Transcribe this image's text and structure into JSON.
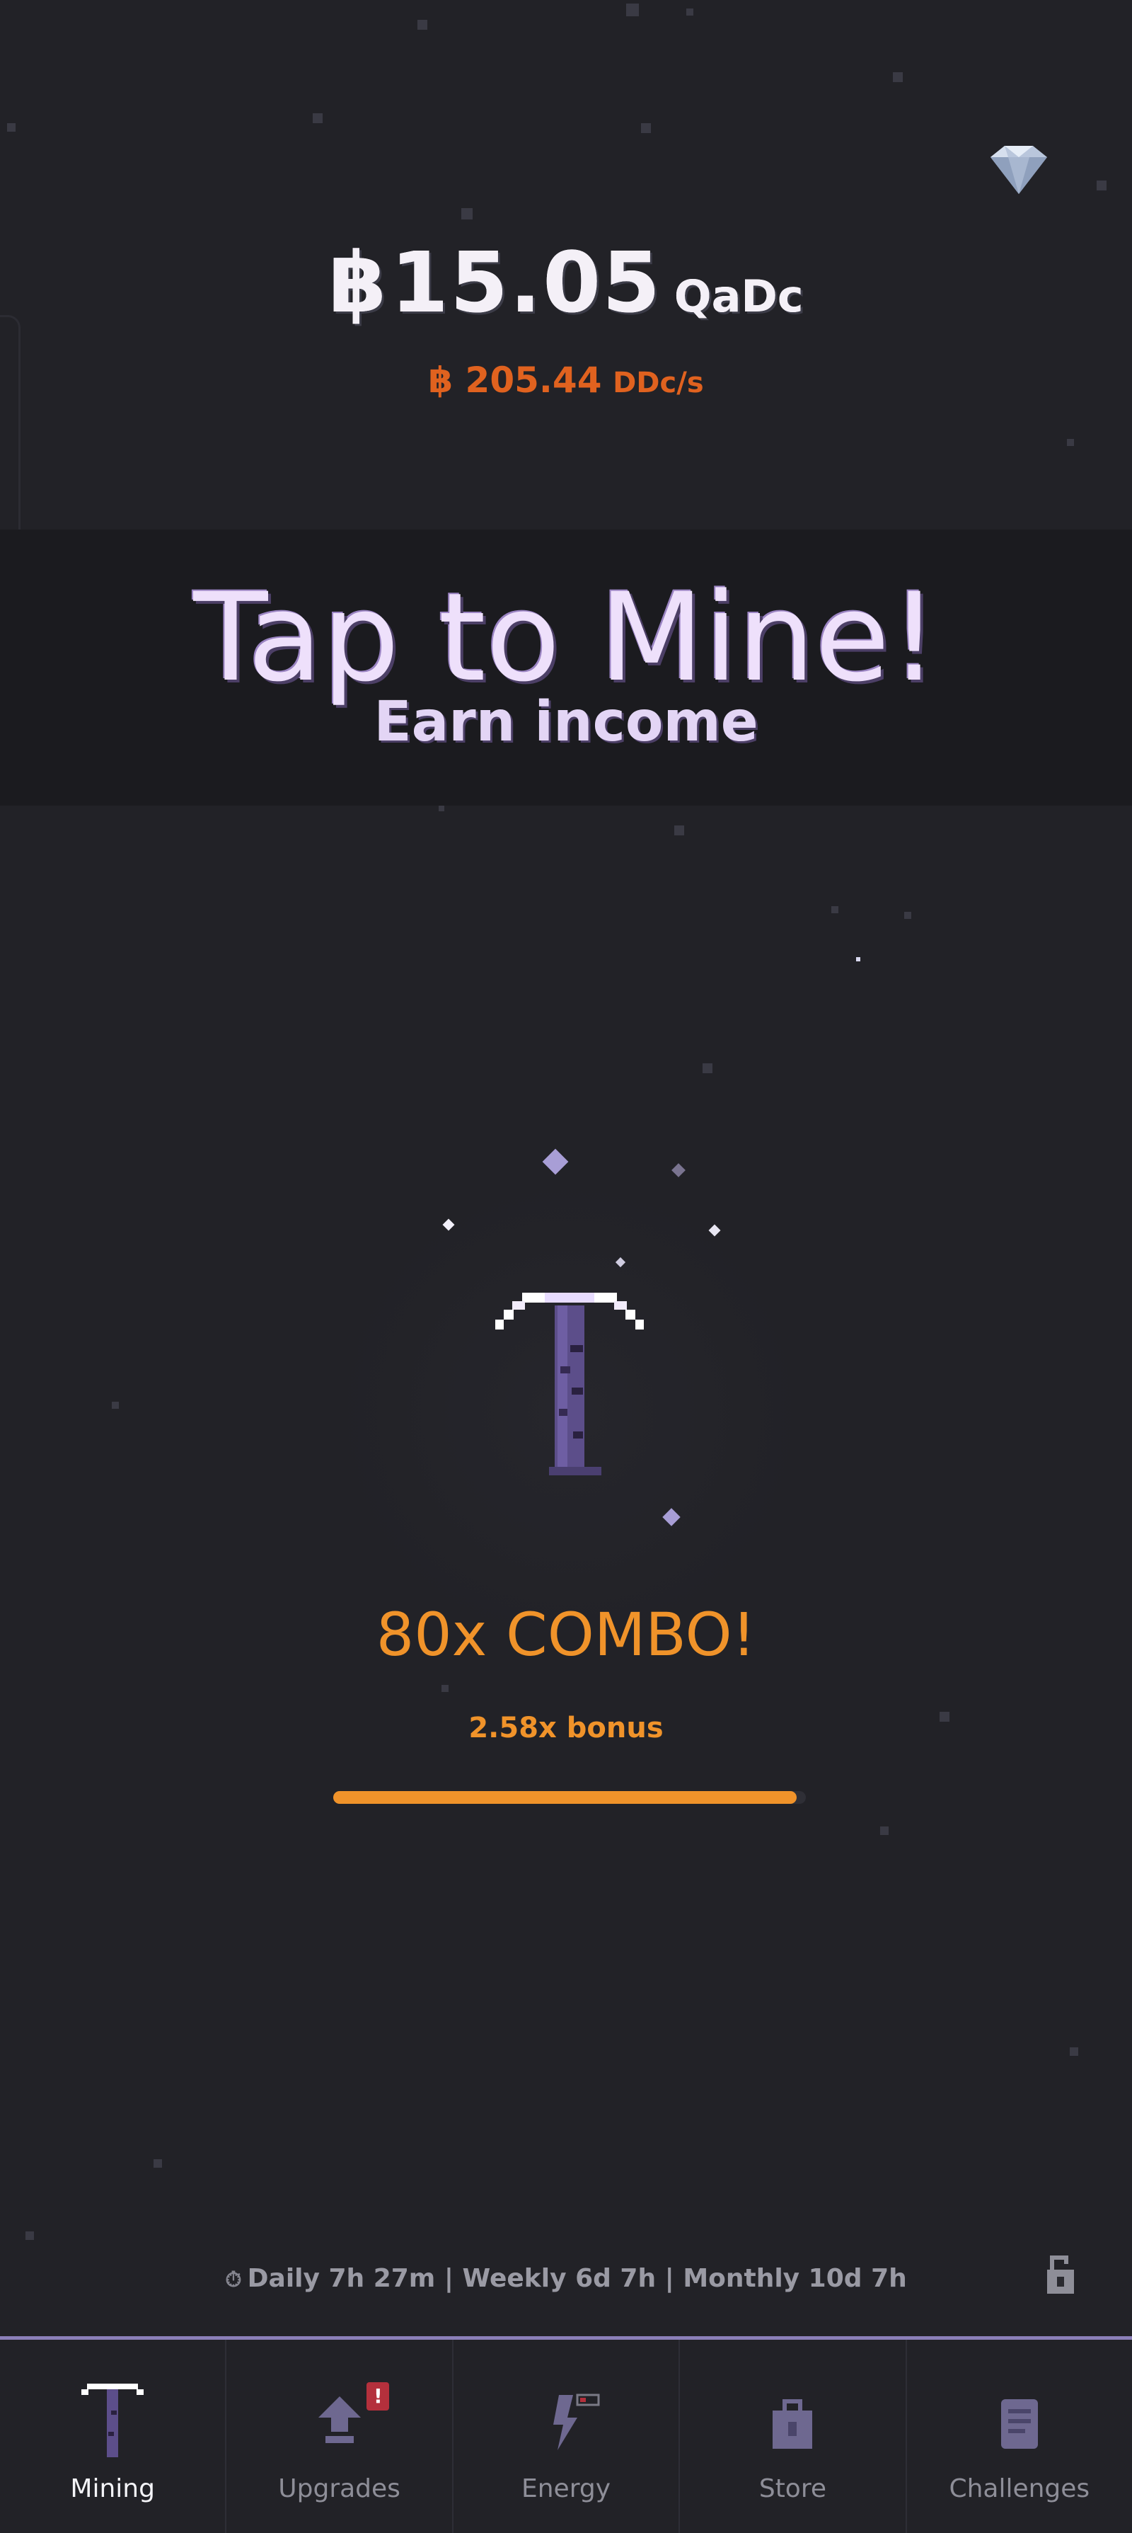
{
  "header": {
    "currency_symbol": "฿",
    "balance_value": "15.05",
    "balance_unit": "QaDc",
    "rate_value": "฿ 205.44",
    "rate_unit": "DDc/s"
  },
  "banner": {
    "title": "Tap to Mine!",
    "subtitle": "Earn income"
  },
  "combo": {
    "label": "80x COMBO!",
    "bonus": "2.58x bonus",
    "progress_fraction": 0.98
  },
  "timers": {
    "text": "Daily 7h 27m | Weekly 6d 7h | Monthly 10d 7h"
  },
  "nav": {
    "items": [
      {
        "label": "Mining",
        "icon": "pickaxe-icon",
        "active": true
      },
      {
        "label": "Upgrades",
        "icon": "upgrade-arrow-icon",
        "badge": "!"
      },
      {
        "label": "Energy",
        "icon": "lightning-icon"
      },
      {
        "label": "Store",
        "icon": "shopping-bag-icon"
      },
      {
        "label": "Challenges",
        "icon": "scroll-icon"
      }
    ]
  },
  "colors": {
    "background": "#222227",
    "rate": "#e0621f",
    "combo": "#f0932a",
    "accent": "#8b7fb8"
  }
}
